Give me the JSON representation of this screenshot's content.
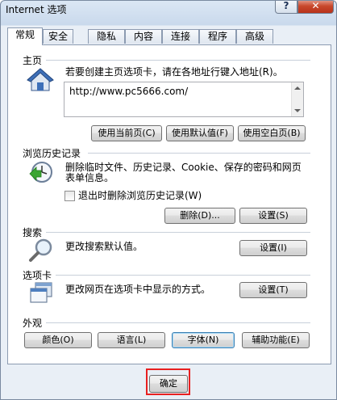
{
  "window": {
    "title": "Internet 选项",
    "help_button": "?",
    "close_button": "✕"
  },
  "tabs": [
    {
      "label": "常规",
      "active": true
    },
    {
      "label": "安全"
    },
    {
      "label": "隐私"
    },
    {
      "label": "内容"
    },
    {
      "label": "连接"
    },
    {
      "label": "程序"
    },
    {
      "label": "高级"
    }
  ],
  "homepage": {
    "title": "主页",
    "description": "若要创建主页选项卡，请在各地址行键入地址(R)。",
    "url": "http://www.pc5666.com/",
    "buttons": [
      "使用当前页(C)",
      "使用默认值(F)",
      "使用空白页(B)"
    ]
  },
  "history": {
    "title": "浏览历史记录",
    "description_line1": "删除临时文件、历史记录、Cookie、保存的密码和网页",
    "description_line2": "表单信息。",
    "checkbox_label": "退出时删除浏览历史记录(W)",
    "delete_button": "删除(D)...",
    "settings_button": "设置(S)"
  },
  "search": {
    "title": "搜索",
    "description": "更改搜索默认值。",
    "settings_button": "设置(I)"
  },
  "tabs_section": {
    "title": "选项卡",
    "description": "更改网页在选项卡中显示的方式。",
    "settings_button": "设置(T)"
  },
  "appearance": {
    "title": "外观",
    "buttons": [
      "颜色(O)",
      "语言(L)",
      "字体(N)",
      "辅助功能(E)"
    ]
  },
  "footer": {
    "ok_button": "确定"
  },
  "colors": {
    "highlight": "#e82020",
    "focus": "#3c7fb1"
  }
}
